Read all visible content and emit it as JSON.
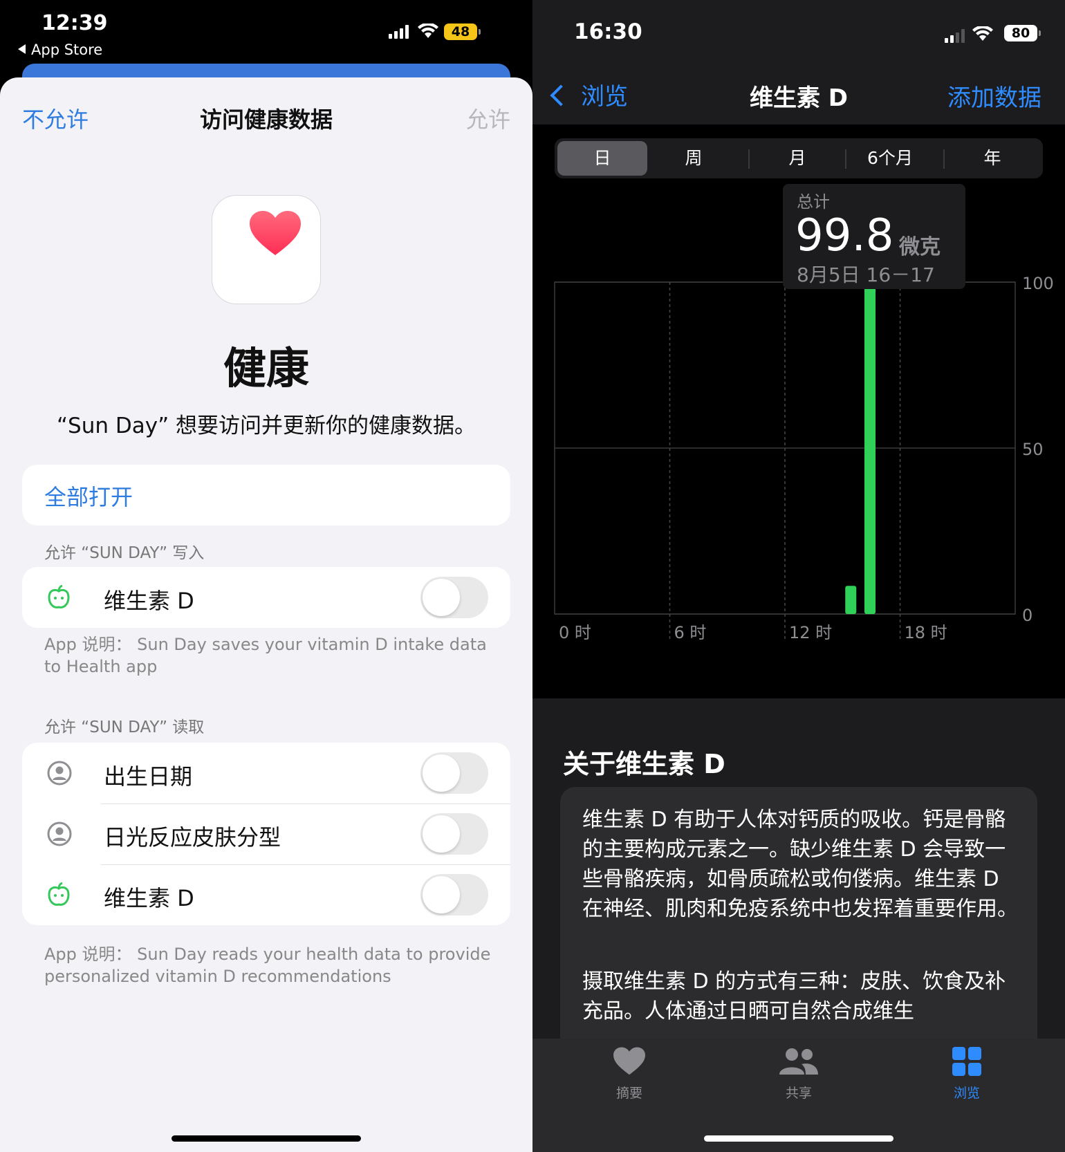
{
  "left": {
    "status": {
      "time": "12:39",
      "back_app": "App Store",
      "battery": "48"
    },
    "nav": {
      "deny": "不允许",
      "title": "访问健康数据",
      "allow": "允许"
    },
    "app": {
      "name": "健康",
      "description": "“Sun Day” 想要访问并更新你的健康数据。"
    },
    "turn_on_all": "全部打开",
    "write_section": {
      "header": "允许 “SUN DAY” 写入",
      "items": [
        {
          "label": "维生素 D",
          "icon": "apple-icon",
          "on": false
        }
      ],
      "footnote": "App 说明： Sun Day saves your vitamin D intake data to Health app"
    },
    "read_section": {
      "header": "允许 “SUN DAY” 读取",
      "items": [
        {
          "label": "出生日期",
          "icon": "person-circle-icon",
          "on": false
        },
        {
          "label": "日光反应皮肤分型",
          "icon": "person-circle-icon",
          "on": false
        },
        {
          "label": "维生素 D",
          "icon": "apple-icon",
          "on": false
        }
      ],
      "footnote": "App 说明： Sun Day reads your health data to provide personalized vitamin D recommendations"
    }
  },
  "right": {
    "status": {
      "time": "16:30",
      "battery": "80"
    },
    "nav": {
      "back": "浏览",
      "title": "维生素 D",
      "add": "添加数据"
    },
    "segments": [
      "日",
      "周",
      "月",
      "6个月",
      "年"
    ],
    "active_segment": "日",
    "tooltip": {
      "label": "总计",
      "value": "99.8",
      "unit": "微克",
      "date": "8月5日 16－17"
    },
    "chart_data": {
      "type": "bar",
      "x_unit": "hour",
      "xlim": [
        0,
        24
      ],
      "ylim": [
        0,
        100
      ],
      "x_ticks": [
        0,
        6,
        12,
        18
      ],
      "x_tick_labels": [
        "0 时",
        "6 时",
        "12 时",
        "18 时"
      ],
      "y_ticks": [
        0,
        50,
        100
      ],
      "y_tick_labels": [
        "0",
        "50",
        "100"
      ],
      "grid": true,
      "bars": [
        {
          "hour": 15,
          "value": 8.5
        },
        {
          "hour": 16,
          "value": 99.8
        }
      ],
      "bar_color": "#30d158"
    },
    "about": {
      "title": "关于维生素 D",
      "paragraphs": [
        "维生素 D 有助于人体对钙质的吸收。钙是骨骼的主要构成元素之一。缺少维生素 D 会导致一些骨骼疾病，如骨质疏松或佝偻病。维生素 D 在神经、肌肉和免疫系统中也发挥着重要作用。",
        "摄取维生素 D 的方式有三种：皮肤、饮食及补充品。人体通过日晒可自然合成维生"
      ]
    },
    "tabbar": [
      {
        "label": "摘要",
        "icon": "heart-icon",
        "active": false
      },
      {
        "label": "共享",
        "icon": "people-icon",
        "active": false
      },
      {
        "label": "浏览",
        "icon": "grid-icon",
        "active": true
      }
    ]
  }
}
